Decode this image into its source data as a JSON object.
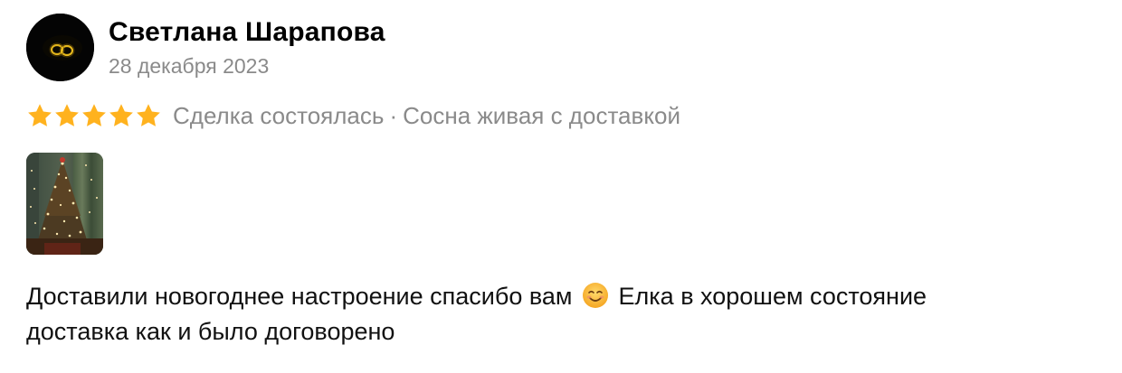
{
  "review": {
    "author_name": "Светлана Шарапова",
    "date": "28 декабря 2023",
    "rating": 5,
    "rating_max": 5,
    "deal_status": "Сделка состоялась",
    "separator": "·",
    "product_name": "Сосна живая с доставкой",
    "text_part1": "Доставили новогоднее настроение спасибо вам",
    "emoji_icon": "smiling-face-icon",
    "text_part2": "Елка в хорошем состояние",
    "text_line2": "доставка как и было договорено"
  },
  "colors": {
    "star": "#FFB21E",
    "secondary_text": "#8a8a8a",
    "text": "#111111"
  }
}
